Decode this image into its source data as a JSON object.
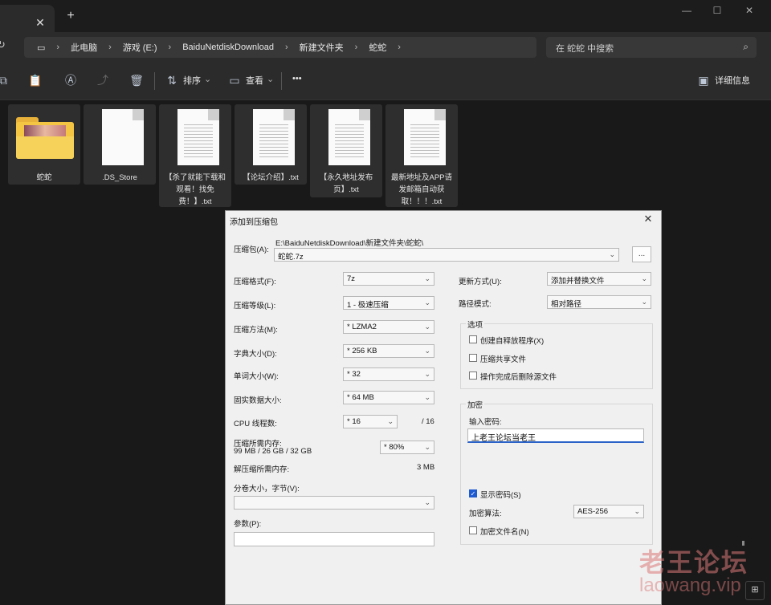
{
  "window": {
    "tab_close": "✕",
    "tab_new": "+",
    "minimize": "—",
    "maximize": "☐",
    "close": "✕"
  },
  "address": {
    "crumbs": [
      "此电脑",
      "游戏 (E:)",
      "BaiduNetdiskDownload",
      "新建文件夹",
      "蛇蛇"
    ],
    "search_placeholder": "在 蛇蛇 中搜索"
  },
  "toolbar": {
    "sort_label": "排序",
    "view_label": "查看",
    "more_label": "•••",
    "details_label": "详细信息"
  },
  "files": [
    {
      "name": "蛇蛇",
      "type": "folder"
    },
    {
      "name": ".DS_Store",
      "type": "file"
    },
    {
      "name": "【杀了就能下载和观看！找免费！】.txt",
      "type": "txt"
    },
    {
      "name": "【论坛介绍】.txt",
      "type": "txt"
    },
    {
      "name": "【永久地址发布页】.txt",
      "type": "txt"
    },
    {
      "name": "最新地址及APP请发邮箱自动获取！！！.txt",
      "type": "txt"
    }
  ],
  "dialog": {
    "title": "添加到压缩包",
    "close": "✕",
    "archive_label": "压缩包(A):",
    "archive_path": "E:\\BaiduNetdiskDownload\\新建文件夹\\蛇蛇\\",
    "archive_name": "蛇蛇.7z",
    "browse_label": "...",
    "left": [
      {
        "label": "压缩格式(F):",
        "value": "7z"
      },
      {
        "label": "压缩等级(L):",
        "value": "1 - 极速压缩"
      },
      {
        "label": "压缩方法(M):",
        "value": "* LZMA2"
      },
      {
        "label": "字典大小(D):",
        "value": "* 256 KB"
      },
      {
        "label": "单词大小(W):",
        "value": "* 32"
      },
      {
        "label": "固实数据大小:",
        "value": "* 64 MB"
      }
    ],
    "cpu_label": "CPU 线程数:",
    "cpu_value": "* 16",
    "cpu_total": "/ 16",
    "mem_label": "压缩所需内存:",
    "mem_detail": "99 MB / 26 GB / 32 GB",
    "mem_value": "* 80%",
    "decomp_label": "解压缩所需内存:",
    "decomp_value": "3 MB",
    "split_label": "分卷大小，字节(V):",
    "split_value": "",
    "params_label": "参数(P):",
    "params_value": "",
    "update_label": "更新方式(U):",
    "update_value": "添加并替换文件",
    "path_label": "路径模式:",
    "path_value": "相对路径",
    "options_title": "选项",
    "options": [
      {
        "label": "创建自释放程序(X)",
        "checked": false
      },
      {
        "label": "压缩共享文件",
        "checked": false
      },
      {
        "label": "操作完成后删除源文件",
        "checked": false
      }
    ],
    "encrypt_title": "加密",
    "password_label": "输入密码:",
    "password_value": "上老王论坛当老王",
    "show_password_label": "显示密码(S)",
    "show_password_checked": true,
    "method_label": "加密算法:",
    "method_value": "AES-256",
    "encrypt_names_label": "加密文件名(N)",
    "encrypt_names_checked": false
  },
  "watermark": {
    "line1": "老王论坛",
    "line2": "laowang.vip"
  }
}
